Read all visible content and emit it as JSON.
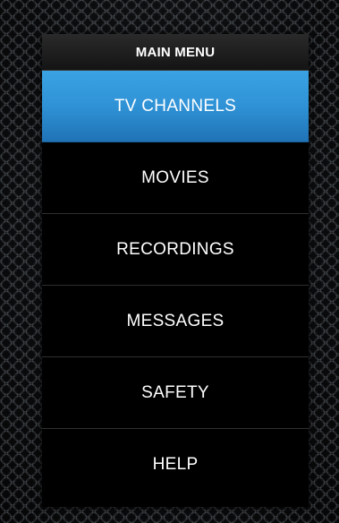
{
  "menu": {
    "header": "MAIN MENU",
    "selected_index": 0,
    "accent_color": "#2f92d6",
    "items": [
      {
        "label": "TV CHANNELS"
      },
      {
        "label": "MOVIES"
      },
      {
        "label": "RECORDINGS"
      },
      {
        "label": "MESSAGES"
      },
      {
        "label": "SAFETY"
      },
      {
        "label": "HELP"
      }
    ]
  }
}
